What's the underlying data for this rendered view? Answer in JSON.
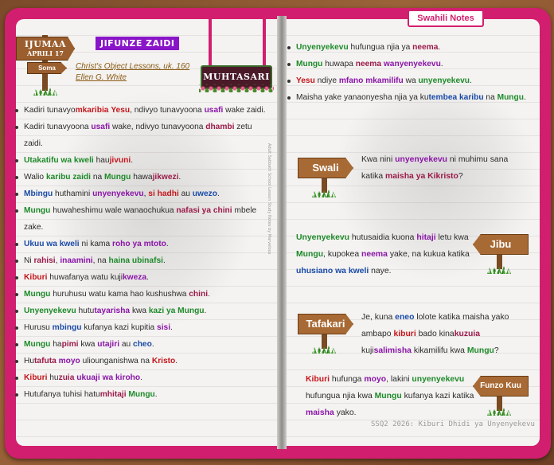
{
  "header": {
    "day": "IJUMAA",
    "date": "APRILI 17",
    "read_label": "Soma",
    "section_title": "JIFUNZE ZAIDI",
    "source_line1": "Christ's Object Lessons, uk. 160",
    "source_line2": "Ellen G. White",
    "hanging_sign": "MUHTASARI",
    "notes_tab": "Swahili Notes",
    "vertical_caption": "Adult Sabbath School Lesson Study Notes by Marvelous"
  },
  "left_notes": [
    [
      [
        "Kadiri tunavyo",
        ""
      ],
      [
        "mkaribia",
        "r"
      ],
      [
        " ",
        ""
      ],
      [
        "Yesu",
        "r"
      ],
      [
        ", ndivyo tunavyoona ",
        ""
      ],
      [
        "usafi",
        "p"
      ],
      [
        " wake zaidi.",
        ""
      ]
    ],
    [
      [
        "Kadiri tunavyoona ",
        ""
      ],
      [
        "usafi",
        "p"
      ],
      [
        " wake, ndivyo tunavyoona ",
        ""
      ],
      [
        "dhambi",
        "m"
      ],
      [
        " zetu zaidi.",
        ""
      ]
    ],
    [
      [
        "Utakatifu wa kweli",
        "g"
      ],
      [
        " hau",
        ""
      ],
      [
        "jivuni",
        "r"
      ],
      [
        ".",
        ""
      ]
    ],
    [
      [
        "Walio ",
        ""
      ],
      [
        "karibu zaidi",
        "g"
      ],
      [
        " na ",
        ""
      ],
      [
        "Mungu",
        "g"
      ],
      [
        " hawa",
        ""
      ],
      [
        "jikwezi",
        "m"
      ],
      [
        ".",
        ""
      ]
    ],
    [
      [
        "Mbingu",
        "b"
      ],
      [
        " huthamini ",
        ""
      ],
      [
        "unyenyekevu",
        "p"
      ],
      [
        ", ",
        ""
      ],
      [
        "si hadhi",
        "r"
      ],
      [
        " au ",
        ""
      ],
      [
        "uwezo",
        "b"
      ],
      [
        ".",
        ""
      ]
    ],
    [
      [
        "Mungu",
        "g"
      ],
      [
        " huwaheshimu wale wanaochukua ",
        ""
      ],
      [
        "nafasi ya chini",
        "m"
      ],
      [
        " mbele zake.",
        ""
      ]
    ],
    [
      [
        "Ukuu wa kweli",
        "b"
      ],
      [
        " ni kama ",
        ""
      ],
      [
        "roho ya mtoto",
        "p"
      ],
      [
        ".",
        ""
      ]
    ],
    [
      [
        "Ni ",
        ""
      ],
      [
        "rahisi",
        "m"
      ],
      [
        ", ",
        ""
      ],
      [
        "inaamini",
        "p"
      ],
      [
        ", na ",
        ""
      ],
      [
        "haina ubinafsi",
        "g"
      ],
      [
        ".",
        ""
      ]
    ],
    [
      [
        "Kiburi",
        "r"
      ],
      [
        " huwafanya watu kuji",
        ""
      ],
      [
        "kweza",
        "p"
      ],
      [
        ".",
        ""
      ]
    ],
    [
      [
        "Mungu",
        "g"
      ],
      [
        " huruhusu watu kama hao kushushwa ",
        ""
      ],
      [
        "chini",
        "m"
      ],
      [
        ".",
        ""
      ]
    ],
    [
      [
        "Unyenyekevu",
        "g"
      ],
      [
        " hutu",
        ""
      ],
      [
        "tayarisha",
        "p"
      ],
      [
        " kwa ",
        ""
      ],
      [
        "kazi ya Mungu",
        "g"
      ],
      [
        ".",
        ""
      ]
    ],
    [
      [
        "Hurusu ",
        ""
      ],
      [
        "mbingu",
        "b"
      ],
      [
        " kufanya kazi kupitia ",
        ""
      ],
      [
        "sisi",
        "p"
      ],
      [
        ".",
        ""
      ]
    ],
    [
      [
        "Mungu",
        "g"
      ],
      [
        " ha",
        ""
      ],
      [
        "pimi",
        "m"
      ],
      [
        " kwa ",
        ""
      ],
      [
        "utajiri",
        "p"
      ],
      [
        " au ",
        ""
      ],
      [
        "cheo",
        "b"
      ],
      [
        ".",
        ""
      ]
    ],
    [
      [
        "Hu",
        ""
      ],
      [
        "tafuta",
        "m"
      ],
      [
        " ",
        ""
      ],
      [
        "moyo",
        "p"
      ],
      [
        " uliounganishwa na ",
        ""
      ],
      [
        "Kristo",
        "r"
      ],
      [
        ".",
        ""
      ]
    ],
    [
      [
        "Kiburi",
        "r"
      ],
      [
        " hu",
        ""
      ],
      [
        "zuia",
        "m"
      ],
      [
        " ",
        ""
      ],
      [
        "ukuaji",
        "p"
      ],
      [
        " ",
        ""
      ],
      [
        "wa kiroho",
        "p"
      ],
      [
        ".",
        ""
      ]
    ],
    [
      [
        "Hutufanya tuhisi hatu",
        ""
      ],
      [
        "mhitaji",
        "m"
      ],
      [
        " ",
        ""
      ],
      [
        "Mungu",
        "g"
      ],
      [
        ".",
        ""
      ]
    ]
  ],
  "right_notes": [
    [
      [
        "Unyenyekevu",
        "g"
      ],
      [
        " hufungua njia ya ",
        ""
      ],
      [
        "neema",
        "m"
      ],
      [
        ".",
        ""
      ]
    ],
    [
      [
        "Mungu",
        "g"
      ],
      [
        " huwapa ",
        ""
      ],
      [
        "neema",
        "m"
      ],
      [
        " ",
        ""
      ],
      [
        "wanyenyekevu",
        "p"
      ],
      [
        ".",
        ""
      ]
    ],
    [
      [
        "Yesu",
        "r"
      ],
      [
        " ndiye ",
        ""
      ],
      [
        "mfano mkamilifu",
        "p"
      ],
      [
        " wa ",
        ""
      ],
      [
        "unyenyekevu",
        "g"
      ],
      [
        ".",
        ""
      ]
    ],
    [
      [
        "Maisha yake yanaonyesha njia ya ku",
        ""
      ],
      [
        "tembea karibu",
        "b"
      ],
      [
        " na ",
        ""
      ],
      [
        "Mungu",
        "g"
      ],
      [
        ".",
        ""
      ]
    ]
  ],
  "cards": {
    "swali": {
      "sign": "Swali",
      "text": [
        [
          "Kwa nini ",
          ""
        ],
        [
          "unyenyekevu",
          "p"
        ],
        [
          " ni muhimu sana katika ",
          ""
        ],
        [
          "maisha ya Kikristo",
          "m"
        ],
        [
          "?",
          ""
        ]
      ]
    },
    "jibu": {
      "sign": "Jibu",
      "text": [
        [
          "Unyenyekevu",
          "g"
        ],
        [
          " hutusaidia kuona ",
          ""
        ],
        [
          "hitaji",
          "p"
        ],
        [
          " letu kwa ",
          ""
        ],
        [
          "Mungu",
          "g"
        ],
        [
          ", kupokea ",
          ""
        ],
        [
          "neema",
          "p"
        ],
        [
          " yake, na kukua katika ",
          ""
        ],
        [
          "uhusiano wa kweli",
          "b"
        ],
        [
          " naye.",
          ""
        ]
      ]
    },
    "tafakari": {
      "sign": "Tafakari",
      "text": [
        [
          "Je, kuna ",
          ""
        ],
        [
          "eneo",
          "b"
        ],
        [
          " lolote katika maisha yako ambapo ",
          ""
        ],
        [
          "kiburi",
          "r"
        ],
        [
          " bado kina",
          ""
        ],
        [
          "kuzuia",
          "m"
        ],
        [
          " kuji",
          ""
        ],
        [
          "salimisha",
          "p"
        ],
        [
          " kikamilifu kwa ",
          ""
        ],
        [
          "Mungu",
          "g"
        ],
        [
          "?",
          ""
        ]
      ]
    },
    "funzo": {
      "sign": "Funzo Kuu",
      "text": [
        [
          "Kiburi",
          "r"
        ],
        [
          " hufunga ",
          ""
        ],
        [
          "moyo",
          "p"
        ],
        [
          ", lakini ",
          ""
        ],
        [
          "unyenyekevu",
          "g"
        ],
        [
          " hufungua njia kwa ",
          ""
        ],
        [
          "Mungu",
          "g"
        ],
        [
          " kufanya kazi katika ",
          ""
        ],
        [
          "maisha",
          "p"
        ],
        [
          " yako.",
          ""
        ]
      ]
    }
  },
  "footer": "SSQ2 2026: Kiburi Dhidi ya Unyenyekevu",
  "colors": {
    "cover": "#d21e6e",
    "green": "#1e8a2a",
    "red": "#c4161c",
    "purple": "#8a14a8",
    "blue": "#1a4aa8",
    "maroon": "#9a1a4a"
  }
}
